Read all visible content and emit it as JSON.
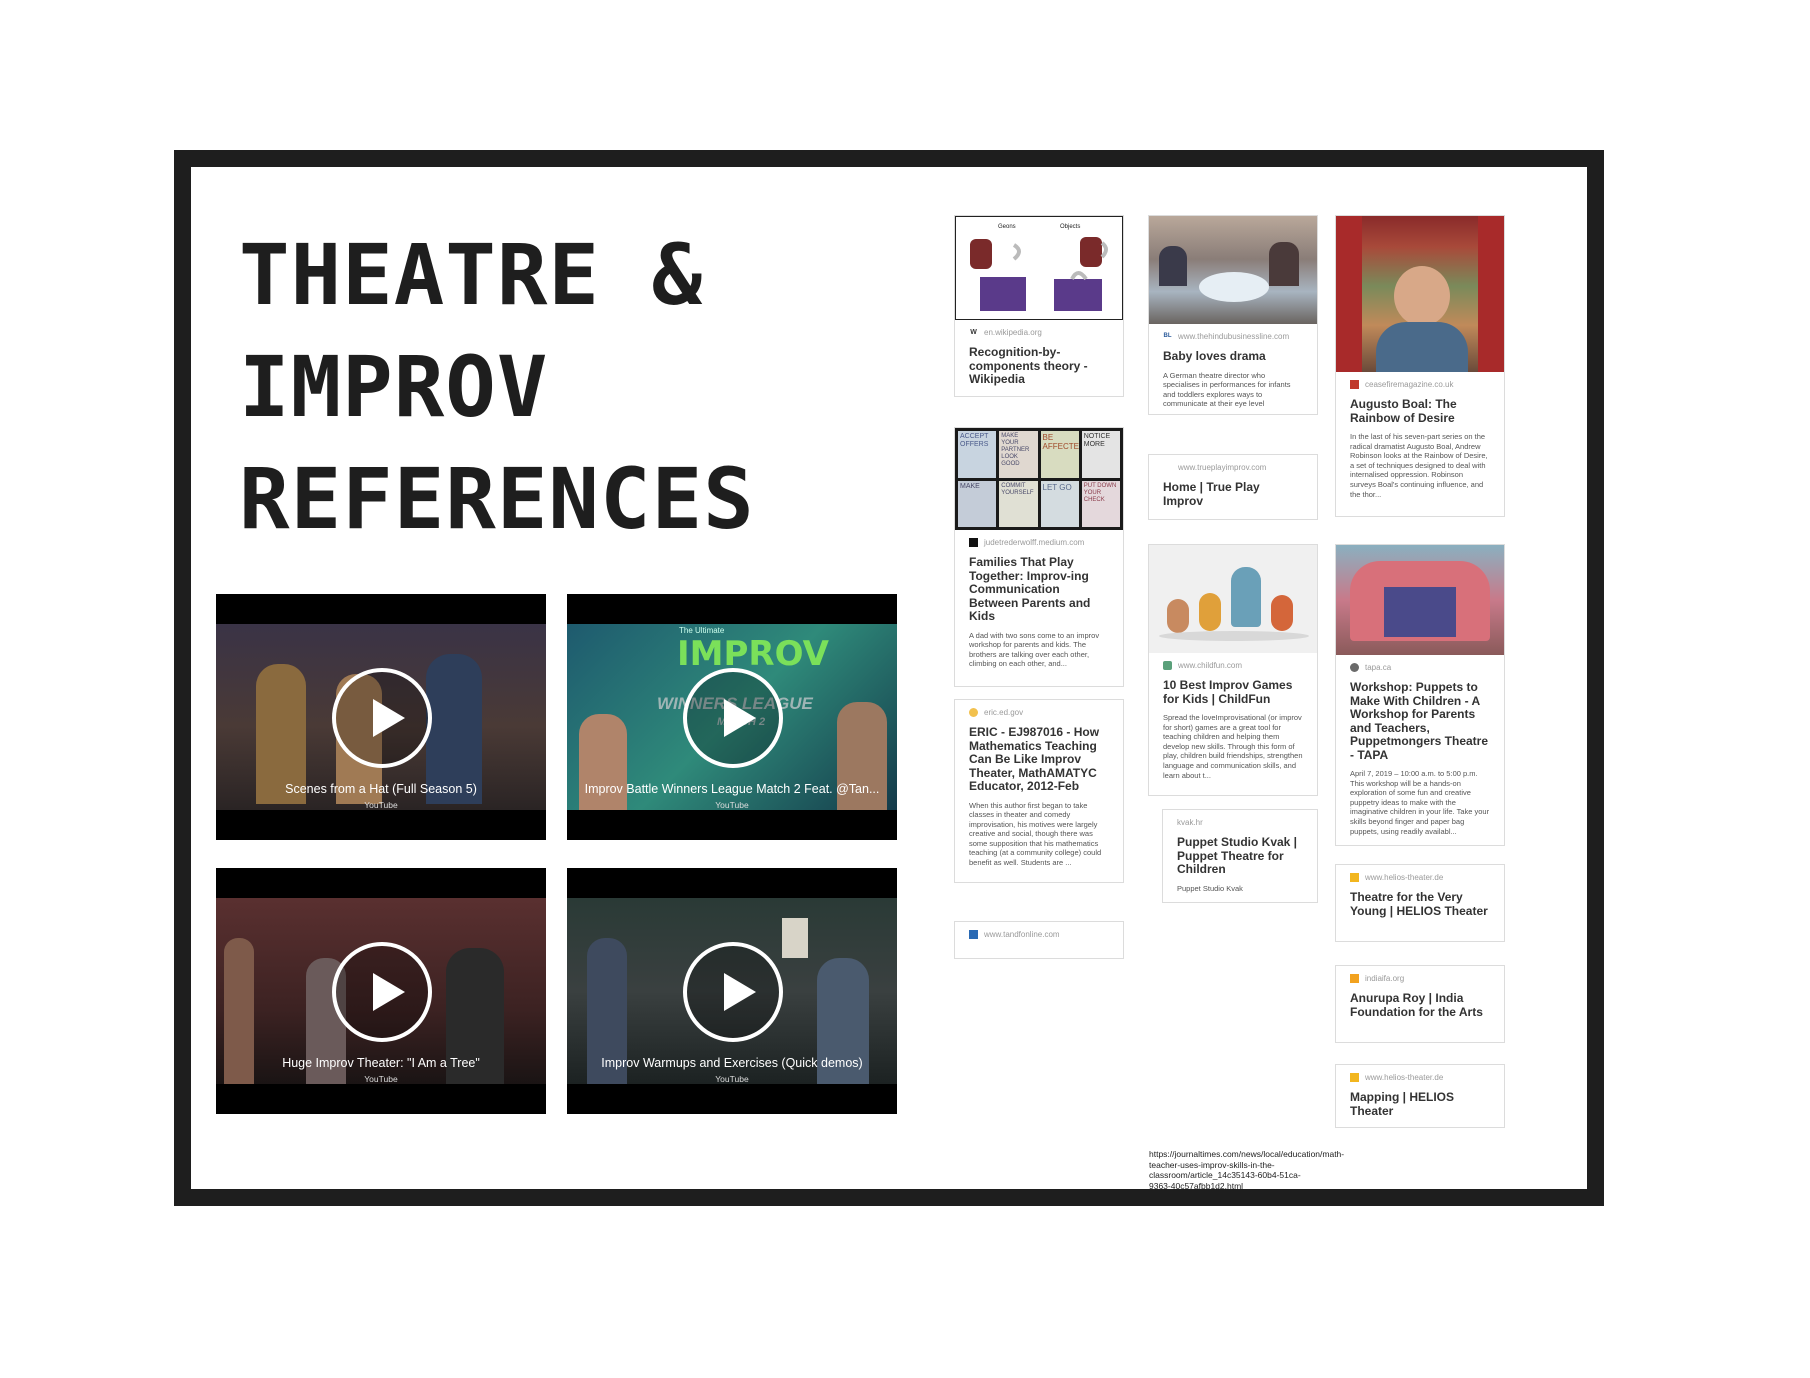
{
  "title_lines": [
    "THEATRE &",
    "IMPROV",
    "REFERENCES"
  ],
  "videos": [
    {
      "title": "Scenes from a Hat (Full Season 5)",
      "source": "YouTube"
    },
    {
      "title": "Improv Battle Winners League Match 2 Feat. @Tan...",
      "source": "YouTube",
      "thumb_text": {
        "line1": "The Ultimate",
        "brand": "IMPROV",
        "sub": "WINNERS LEAGUE",
        "match": "MATCH 2"
      }
    },
    {
      "title": "Huge Improv Theater: \"I Am a Tree\"",
      "source": "YouTube"
    },
    {
      "title": "Improv Warmups and Exercises (Quick demos)",
      "source": "YouTube"
    }
  ],
  "cards": {
    "wiki": {
      "source": "en.wikipedia.org",
      "title": "Recognition-by-components theory - Wikipedia",
      "fig_labels": [
        "Geons",
        "Objects"
      ],
      "favicon": "W"
    },
    "medium": {
      "source": "judetrederwolff.medium.com",
      "title": "Families That Play Together: Improv-ing Communication Between Parents and Kids",
      "desc": "A dad with two sons come to an improv workshop for parents and kids. The brothers are talking over each other, climbing on each other, and...",
      "tiles": [
        "ACCEPT OFFERS",
        "MAKE YOUR PARTNER LOOK GOOD",
        "BE AFFECTED",
        "NOTICE MORE",
        "MAKE",
        "COMMIT YOURSELF",
        "LET GO",
        "PUT DOWN YOUR CHECK"
      ]
    },
    "eric": {
      "source": "eric.ed.gov",
      "title": "ERIC - EJ987016 - How Mathematics Teaching Can Be Like Improv Theater, MathAMATYC Educator, 2012-Feb",
      "desc": "When this author first began to take classes in theater and comedy improvisation, his motives were largely creative and social, though there was some supposition that his mathematics teaching (at a community college) could benefit as well. Students are ..."
    },
    "tandf": {
      "source": "www.tandfonline.com"
    },
    "url_note": "https://journaltimes.com/news/local/education/math-teacher-uses-improv-skills-in-the-classroom/article_14c35143-60b4-51ca-9363-40c57afbb1d2.html",
    "hindu": {
      "source": "www.thehindubusinessline.com",
      "title": "Baby loves drama",
      "desc": "A German theatre director who specialises in performances for infants and toddlers explores ways to communicate at their eye level",
      "favicon": "BL"
    },
    "trueplay": {
      "source": "www.trueplayimprov.com",
      "title": "Home | True Play Improv"
    },
    "childfun": {
      "source": "www.childfun.com",
      "title": "10 Best Improv Games for Kids | ChildFun",
      "desc": "Spread the loveImprovisational (or improv for short) games are a great tool for teaching children and helping them develop new skills. Through this form of play, children build friendships, strengthen language and communication skills, and learn about t..."
    },
    "kvak": {
      "source": "kvak.hr",
      "title": "Puppet Studio Kvak | Puppet Theatre for Children",
      "desc": "Puppet Studio Kvak"
    },
    "ceasefire": {
      "source": "ceasefiremagazine.co.uk",
      "title": "Augusto Boal: The Rainbow of Desire",
      "desc": "In the last of his seven-part series on the radical dramatist Augusto Boal, Andrew Robinson looks at the Rainbow of Desire, a set of techniques designed to deal with internalised oppression. Robinson surveys Boal's continuing influence, and the thor..."
    },
    "tapa": {
      "source": "tapa.ca",
      "title": "Workshop: Puppets to Make With Children - A Workshop for Parents and Teachers, Puppetmongers Theatre - TAPA",
      "desc": "April 7, 2019 – 10:00 a.m. to 5:00 p.m. This workshop will be a hands-on exploration of some fun and creative puppetry ideas to make with the imaginative children in your life. Take your skills beyond finger and paper bag puppets, using readily availabl..."
    },
    "helios1": {
      "source": "www.helios-theater.de",
      "title": "Theatre for the Very Young | HELIOS Theater"
    },
    "indiafa": {
      "source": "indiaifa.org",
      "title": "Anurupa Roy | India Foundation for the Arts"
    },
    "helios2": {
      "source": "www.helios-theater.de",
      "title": "Mapping | HELIOS Theater"
    }
  },
  "colors": {
    "frame": "#1e1e1e",
    "card_border": "#dcdcdc",
    "title_text": "#1e1e1e"
  }
}
